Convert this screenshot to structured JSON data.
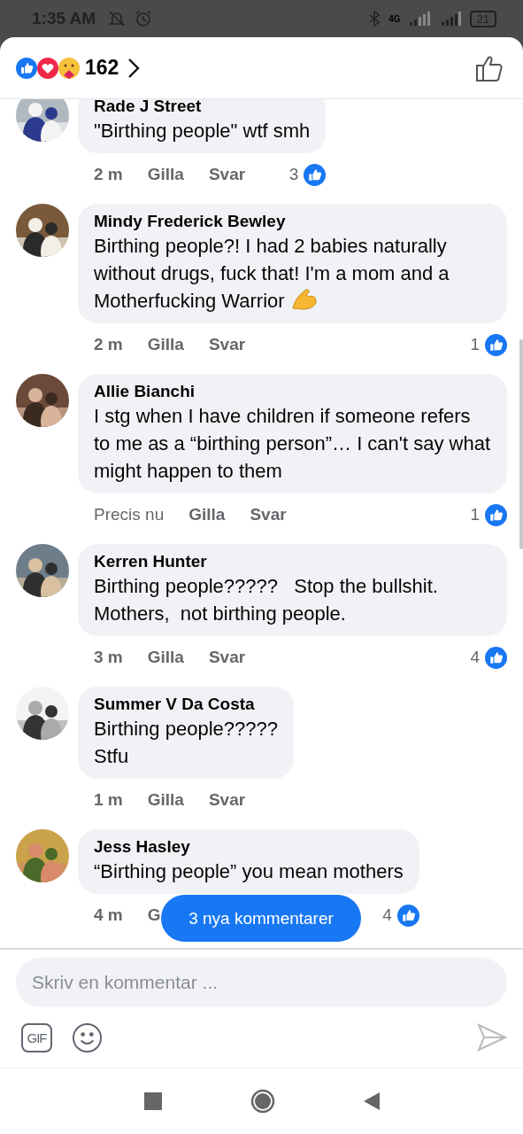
{
  "status_bar": {
    "time": "1:35 AM",
    "network": "4G",
    "battery": "21"
  },
  "header": {
    "reaction_count": "162"
  },
  "comments": [
    {
      "author": "Rade J Street",
      "text": "\"Birthing people\" wtf smh",
      "has_emoji": false,
      "time": "2 m",
      "actions": [
        "Gilla",
        "Svar"
      ],
      "likes": "3"
    },
    {
      "author": "Mindy Frederick Bewley",
      "text": "Birthing people?! I had 2 babies naturally without drugs, fuck that! I'm a mom and a Motherfucking Warrior",
      "has_emoji": true,
      "time": "2 m",
      "actions": [
        "Gilla",
        "Svar"
      ],
      "likes": "1"
    },
    {
      "author": "Allie Bianchi",
      "text": "I stg when I have children if someone refers to me as a “birthing person”… I can't say what might happen to them",
      "has_emoji": false,
      "time": "Precis nu",
      "actions": [
        "Gilla",
        "Svar"
      ],
      "likes": "1"
    },
    {
      "author": "Kerren Hunter",
      "text": "Birthing people?????   Stop the bullshit. Mothers,  not birthing people.",
      "has_emoji": false,
      "time": "3 m",
      "actions": [
        "Gilla",
        "Svar"
      ],
      "likes": "4"
    },
    {
      "author": "Summer V Da Costa",
      "text": "Birthing people?????\nStfu",
      "has_emoji": false,
      "time": "1 m",
      "actions": [
        "Gilla",
        "Svar"
      ]
    },
    {
      "author": "Jess Hasley",
      "text": "“Birthing people” you mean mothers",
      "has_emoji": false,
      "time": "4 m",
      "actions": [
        "G"
      ],
      "likes": "4"
    }
  ],
  "new_comments_button": "3 nya kommentarer",
  "composer": {
    "placeholder": "Skriv en kommentar ...",
    "gif_label": "GIF"
  }
}
